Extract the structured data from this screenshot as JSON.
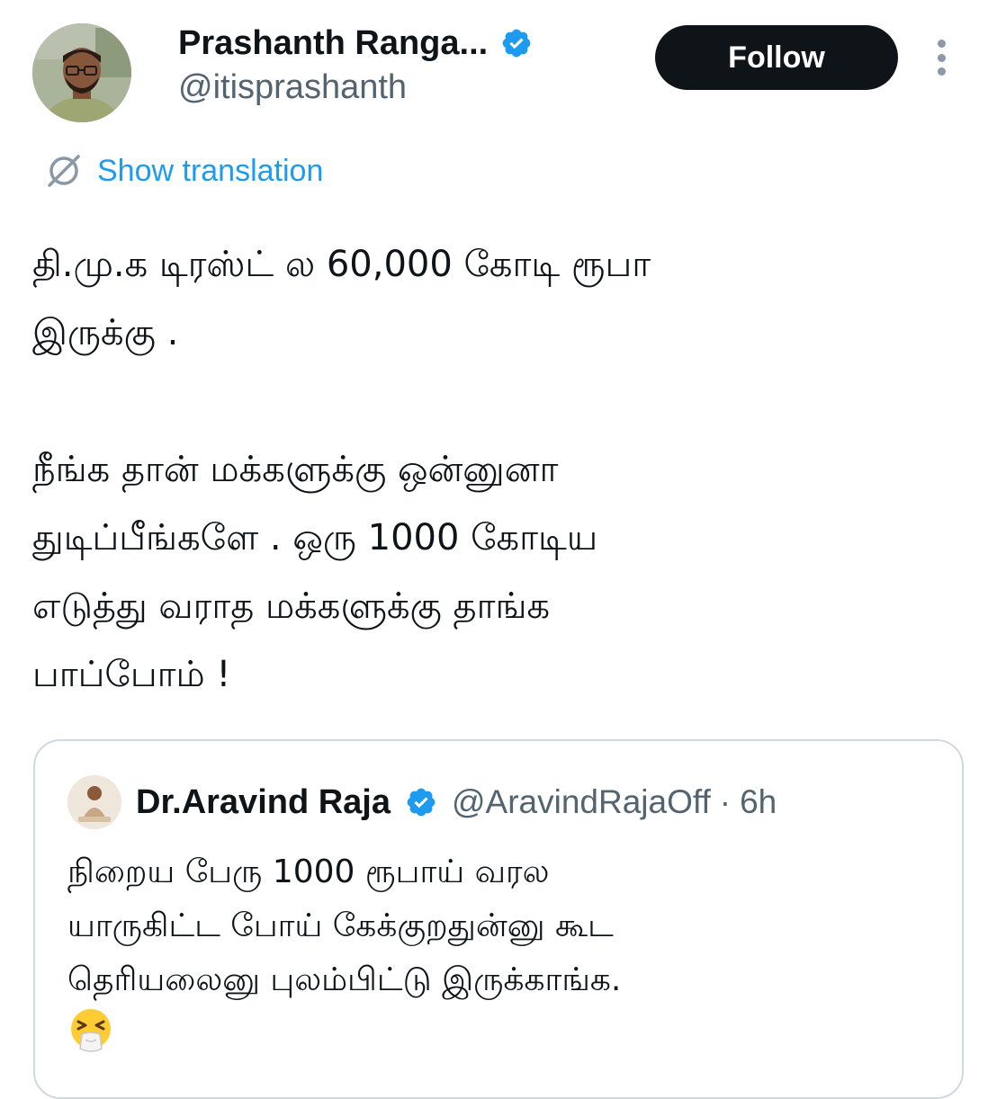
{
  "author": {
    "display_name": "Prashanth Ranga...",
    "handle": "@itisprashanth",
    "avatar_icon": "profile-photo",
    "verified": true
  },
  "actions": {
    "follow_label": "Follow",
    "more_icon": "more-vertical-icon"
  },
  "translation": {
    "label": "Show translation",
    "icon": "translate-icon"
  },
  "tweet": {
    "text": "தி.மு.க டிரஸ்ட் ல 60,000 கோடி ரூபா\nஇருக்கு .\n\nநீங்க தான் மக்களுக்கு ஒன்னுனா\nதுடிப்பீங்களே . ஒரு 1000 கோடிய\nஎடுத்து வராத மக்களுக்கு தாங்க\nபாப்போம் !"
  },
  "quoted_tweet": {
    "display_name": "Dr.Aravind Raja",
    "handle": "@AravindRajaOff",
    "separator": "·",
    "time": "6h",
    "verified": true,
    "text": "நிறைய பேரு 1000 ரூபாய் வரல\nயாருகிட்ட போய் கேக்குறதுன்னு கூட\nதெரியலைனு புலம்பிட்டு இருக்காங்க.",
    "emoji_icon": "sneezing-face-emoji"
  },
  "colors": {
    "text_primary": "#0f1419",
    "text_secondary": "#536471",
    "accent_blue": "#1d9bf0",
    "button_dark": "#0f1419",
    "border": "#cfd9de"
  }
}
